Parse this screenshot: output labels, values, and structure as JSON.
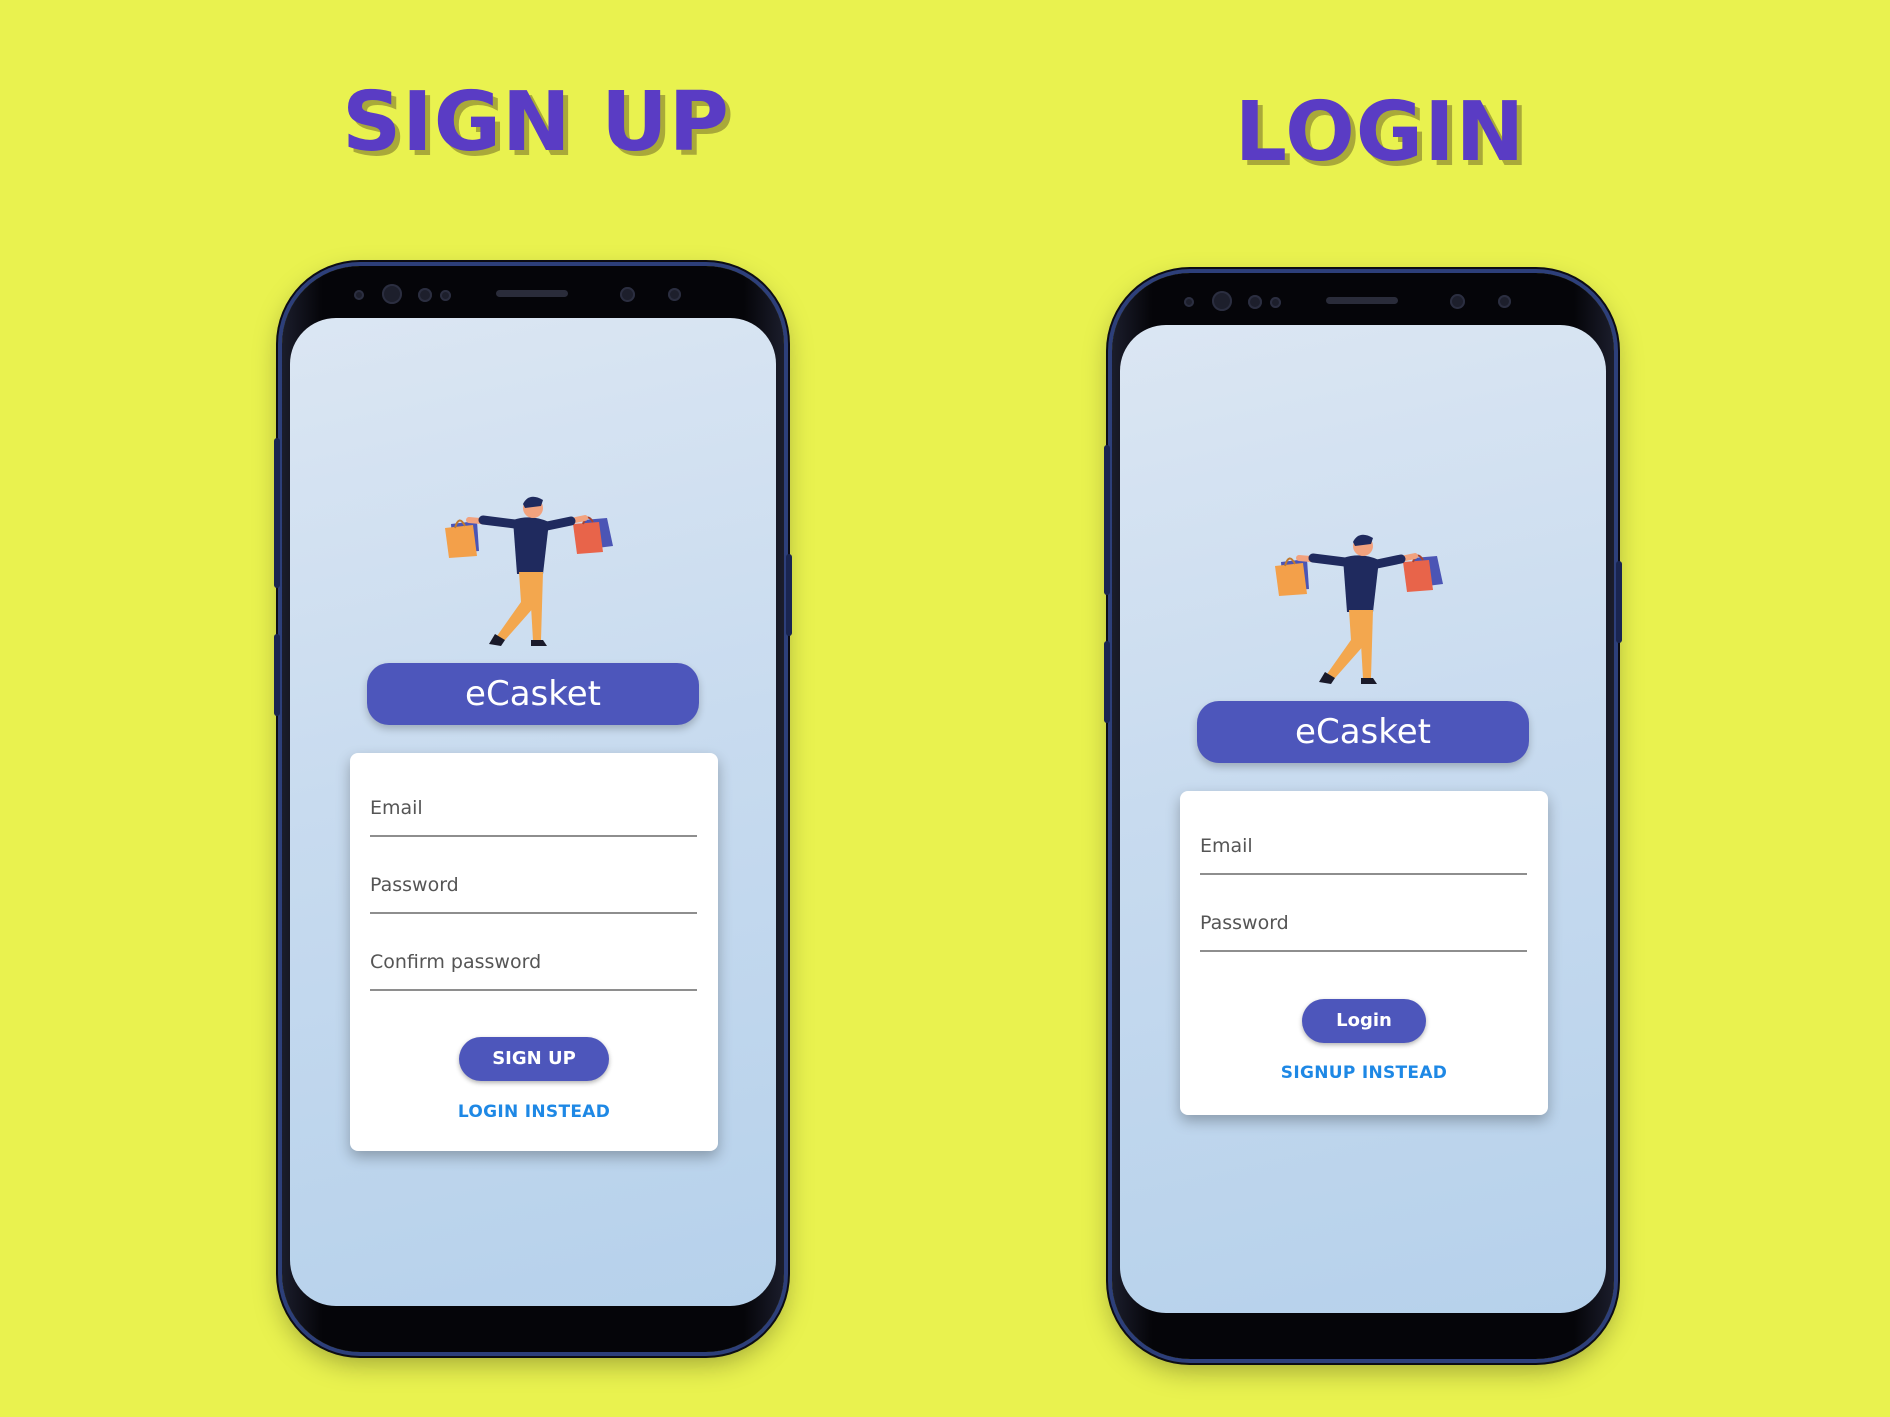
{
  "page": {
    "background_color": "#e9f24f",
    "accent_color": "#4d56bb",
    "link_color": "#1e88e5",
    "headline_color": "#5a3cc4"
  },
  "signup_screen": {
    "headline": "SIGN UP",
    "brand": "eCasket",
    "illustration": "shopper-with-bags-illustration",
    "fields": [
      {
        "label": "Email"
      },
      {
        "label": "Password"
      },
      {
        "label": "Confirm password"
      }
    ],
    "primary_button": "SIGN UP",
    "secondary_link": "LOGIN INSTEAD"
  },
  "login_screen": {
    "headline": "LOGIN",
    "brand": "eCasket",
    "illustration": "shopper-with-bags-illustration",
    "fields": [
      {
        "label": "Email"
      },
      {
        "label": "Password"
      }
    ],
    "primary_button": "Login",
    "secondary_link": "SIGNUP INSTEAD"
  }
}
